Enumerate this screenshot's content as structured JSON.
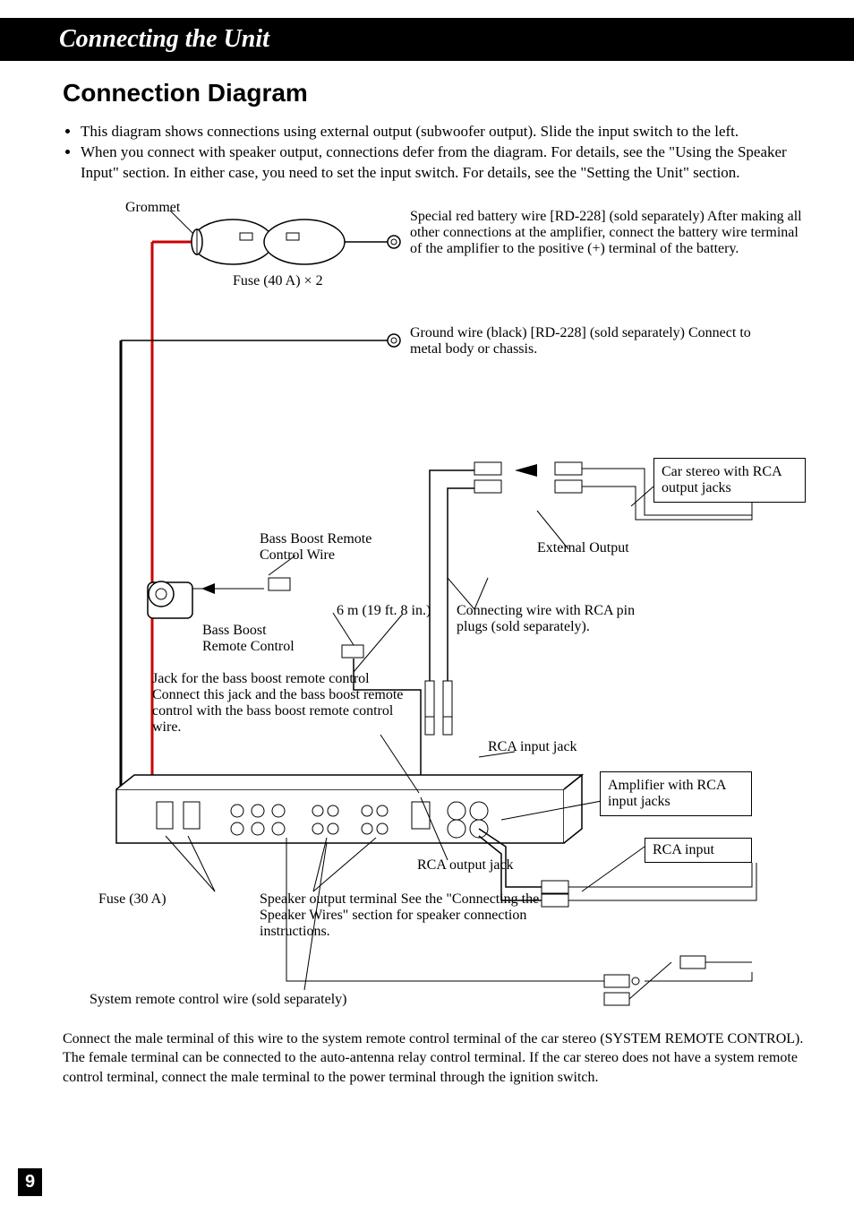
{
  "section_title": "Connecting the Unit",
  "sub_heading": "Connection Diagram",
  "bullets": [
    "This diagram shows connections using external output (subwoofer output). Slide the input switch to the left.",
    "When you connect with speaker output, connections defer from the diagram. For details, see the \"Using the Speaker Input\" section. In either case, you need to set the input switch. For details, see the \"Setting the Unit\" section."
  ],
  "labels": {
    "grommet": "Grommet",
    "fuse_top": "Fuse (40 A) × 2",
    "battery_wire": "Special red battery wire [RD-228] (sold separately) After making all other connections at the amplifier, connect the battery wire terminal of the amplifier to the positive (+) terminal of the battery.",
    "ground_wire": "Ground wire (black) [RD-228] (sold separately) Connect to metal body or chassis.",
    "bass_boost_wire": "Bass Boost Remote Control Wire",
    "bass_boost_remote": "Bass Boost Remote Control",
    "length": "6 m (19 ft. 8 in.)",
    "jack_text": "Jack for the bass boost remote control Connect this jack and the bass boost remote control with the bass boost remote control wire.",
    "car_stereo": "Car stereo with RCA output jacks",
    "external_output": "External Output",
    "rca_wire": "Connecting wire with RCA pin plugs (sold separately).",
    "rca_input_jack": "RCA input jack",
    "amp_rca": "Amplifier with RCA input jacks",
    "rca_input": "RCA input",
    "rca_output_jack": "RCA output jack",
    "fuse_side": "Fuse (30 A)",
    "speaker_output": "Speaker output terminal See the \"Connecting the Speaker Wires\" section for speaker connection instructions.",
    "system_remote_title": "System remote control wire (sold separately)",
    "system_remote_body": "Connect the male terminal of this wire to the system remote control terminal of the car stereo (SYSTEM REMOTE CONTROL). The female terminal can be connected to the auto-antenna relay control terminal. If the car stereo does not have a system remote control terminal, connect the male terminal to the power terminal through the ignition switch."
  },
  "page_number": "9"
}
